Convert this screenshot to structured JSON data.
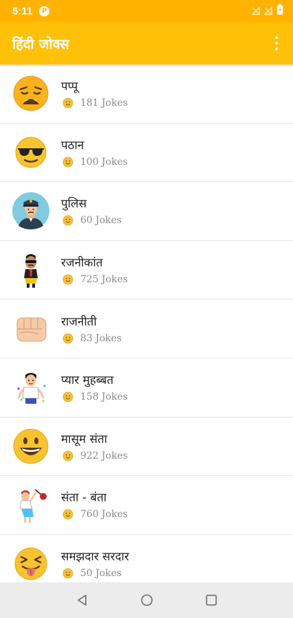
{
  "status": {
    "time": "5:11",
    "icons": [
      "p-notification-icon",
      "signal-off-icon",
      "signal-off-icon",
      "battery-icon"
    ]
  },
  "app_bar": {
    "title": "हिंदी जोक्स",
    "menu_icon": "more-vert-icon"
  },
  "colors": {
    "status_bar": "#FFB300",
    "app_bar": "#FFC107",
    "count_text": "#888888"
  },
  "categories": [
    {
      "title": "पप्पू",
      "count": "181 Jokes",
      "icon": "weary-face-icon"
    },
    {
      "title": "पठान",
      "count": "100 Jokes",
      "icon": "sunglasses-face-icon"
    },
    {
      "title": "पुलिस",
      "count": "60 Jokes",
      "icon": "police-officer-icon"
    },
    {
      "title": "रजनीकांत",
      "count": "725 Jokes",
      "icon": "rajnikant-cartoon-icon"
    },
    {
      "title": "राजनीती",
      "count": "83 Jokes",
      "icon": "fist-icon"
    },
    {
      "title": "प्यार मुहब्बत",
      "count": "158 Jokes",
      "icon": "love-cartoon-icon"
    },
    {
      "title": "मासूम संता",
      "count": "922 Jokes",
      "icon": "grinning-face-icon"
    },
    {
      "title": "संता - बंता",
      "count": "760 Jokes",
      "icon": "traveller-cartoon-icon"
    },
    {
      "title": "समझदार सरदार",
      "count": "50 Jokes",
      "icon": "tongue-face-icon"
    }
  ],
  "nav": {
    "back_icon": "back-triangle-icon",
    "home_icon": "home-circle-icon",
    "recents_icon": "recents-square-icon"
  }
}
